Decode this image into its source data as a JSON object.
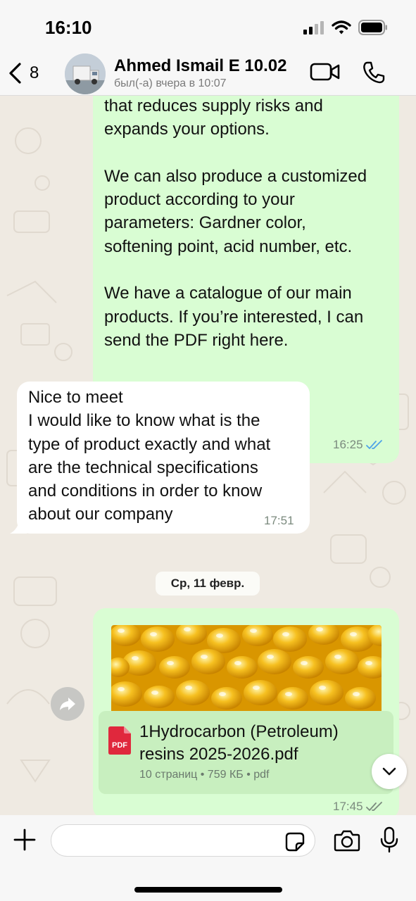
{
  "status_bar": {
    "time": "16:10"
  },
  "header": {
    "back_count": "8",
    "contact_name": "Ahmed Ismail E 10.02",
    "contact_status": "был(-а) вчера в 10:07"
  },
  "messages": {
    "outgoing_1": {
      "text": "that reduces supply risks and\nexpands your options.\n\nWe can also produce a customized\nproduct according to your\nparameters: Gardner color,\nsoftening point, acid number, etc.\n\nWe have a catalogue of our main\nproducts. If you’re interested, I can\nsend the PDF right here.",
      "time": "16:25",
      "status": "read"
    },
    "incoming_1": {
      "text": "Nice to meet\nI would like to know what is the\ntype of product exactly and what\nare the technical specifications\nand conditions in order to know\nabout our company",
      "time": "17:51"
    },
    "date_separator": "Ср, 11 февр.",
    "outgoing_document": {
      "file_name": "1Hydrocarbon (Petroleum) resins 2025-2026.pdf",
      "file_type_label": "PDF",
      "details": "10 страниц • 759 КБ • pdf",
      "time": "17:45",
      "status": "delivered"
    }
  },
  "colors": {
    "outgoing_bubble": "#d9fdd3",
    "incoming_bubble": "#ffffff",
    "read_ticks": "#4fa3e8",
    "pdf_red": "#e0283d",
    "background": "#efeae2"
  },
  "icons": {
    "back": "chevron-left-icon",
    "video": "video-camera-icon",
    "call": "phone-icon",
    "forward": "forward-arrow-icon",
    "scroll_down": "chevron-down-icon",
    "attach": "plus-icon",
    "sticker": "sticker-icon",
    "camera": "camera-icon",
    "mic": "microphone-icon"
  }
}
